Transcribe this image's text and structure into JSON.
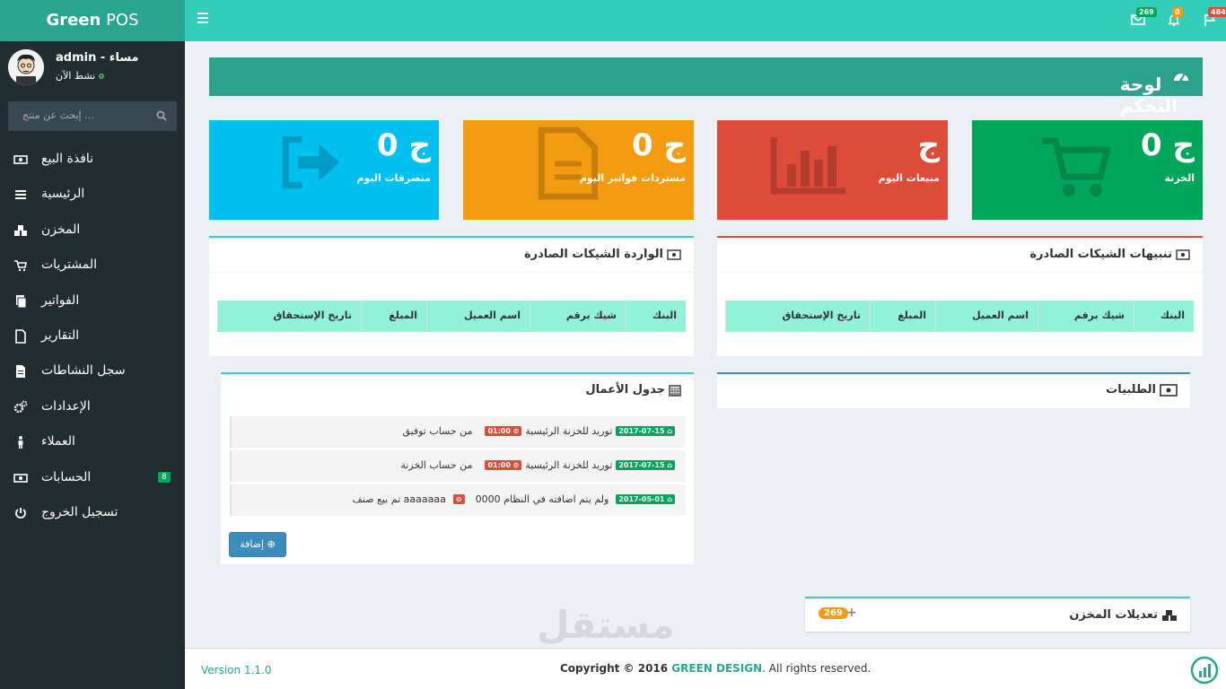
{
  "brand": {
    "name_bold": "Green",
    "name_rest": " POS"
  },
  "topbar": {
    "messages_count": "269",
    "notifications_count": "0",
    "flags_count": "484"
  },
  "user": {
    "name": "admin - مساء",
    "status": "نشط الآن"
  },
  "search": {
    "placeholder": "إبحث عن منتج ..."
  },
  "menu": [
    {
      "label": "نافذة البيع",
      "icon": "money-icon"
    },
    {
      "label": "الرئيسية",
      "icon": "list-icon"
    },
    {
      "label": "المخزن",
      "icon": "cubes-icon"
    },
    {
      "label": "المشتريات",
      "icon": "cart-icon"
    },
    {
      "label": "الفواتير",
      "icon": "files-icon"
    },
    {
      "label": "التقارير",
      "icon": "file-icon"
    },
    {
      "label": "سجل النشاطات",
      "icon": "file-text-icon"
    },
    {
      "label": "الإعدادات",
      "icon": "gears-icon"
    },
    {
      "label": "العملاء",
      "icon": "male-icon"
    },
    {
      "label": "الحسابات",
      "icon": "money-icon",
      "count": "8"
    },
    {
      "label": "تسجيل الخروج",
      "icon": "power-icon"
    }
  ],
  "page_title": "لوحة التحكم",
  "stats": [
    {
      "value": "0 ج",
      "label": "الخزنة",
      "color": "#00a65a",
      "icon": "cart-icon"
    },
    {
      "value": "ج",
      "label": "مبيعات اليوم",
      "color": "#dd4b39",
      "icon": "bar-chart-icon"
    },
    {
      "value": "0 ج",
      "label": "مستردات فواتير اليوم",
      "color": "#f39c12",
      "icon": "file-text-icon"
    },
    {
      "value": "0 ج",
      "label": "منصرفات اليوم",
      "color": "#00c0ef",
      "icon": "sign-out-icon"
    }
  ],
  "cheques_alert": {
    "title": "تنبيهات الشيكات الصادرة",
    "columns": [
      "البنك",
      "شيك برقم",
      "اسم العميل",
      "المبلغ",
      "تاريخ الإستحقاق"
    ]
  },
  "cheques_incoming": {
    "title": "الواردة الشيكات الصادرة",
    "columns": [
      "البنك",
      "شيك برقم",
      "اسم العميل",
      "المبلغ",
      "تاريخ الإستحقاق"
    ]
  },
  "orders": {
    "title": "الطلبيات"
  },
  "schedule": {
    "title": "جدول الأعمال",
    "tasks": [
      {
        "text": "توريد للخزنة الرئيسية",
        "time": "01:00",
        "note": "من حساب توفيق",
        "date": "2017-07-15"
      },
      {
        "text": "توريد للخزنة الرئيسية",
        "time": "01:00",
        "note": "من حساب الخزنة",
        "date": "2017-07-15"
      },
      {
        "text": "تم بيع صنف aaaaaaa",
        "time": "",
        "note": "ولم يتم اضافته في النظام 0000",
        "date": "2017-05-01"
      }
    ],
    "add_label": "إضافة"
  },
  "stock_adjust": {
    "title": "تعديلات المخزن",
    "count": "269"
  },
  "footer": {
    "version": "Version 1.1.0",
    "copy_prefix": "Copyright © 2016 ",
    "company": "GREEN DESIGN",
    "copy_suffix": ". All rights reserved."
  },
  "watermark": "مستقل"
}
